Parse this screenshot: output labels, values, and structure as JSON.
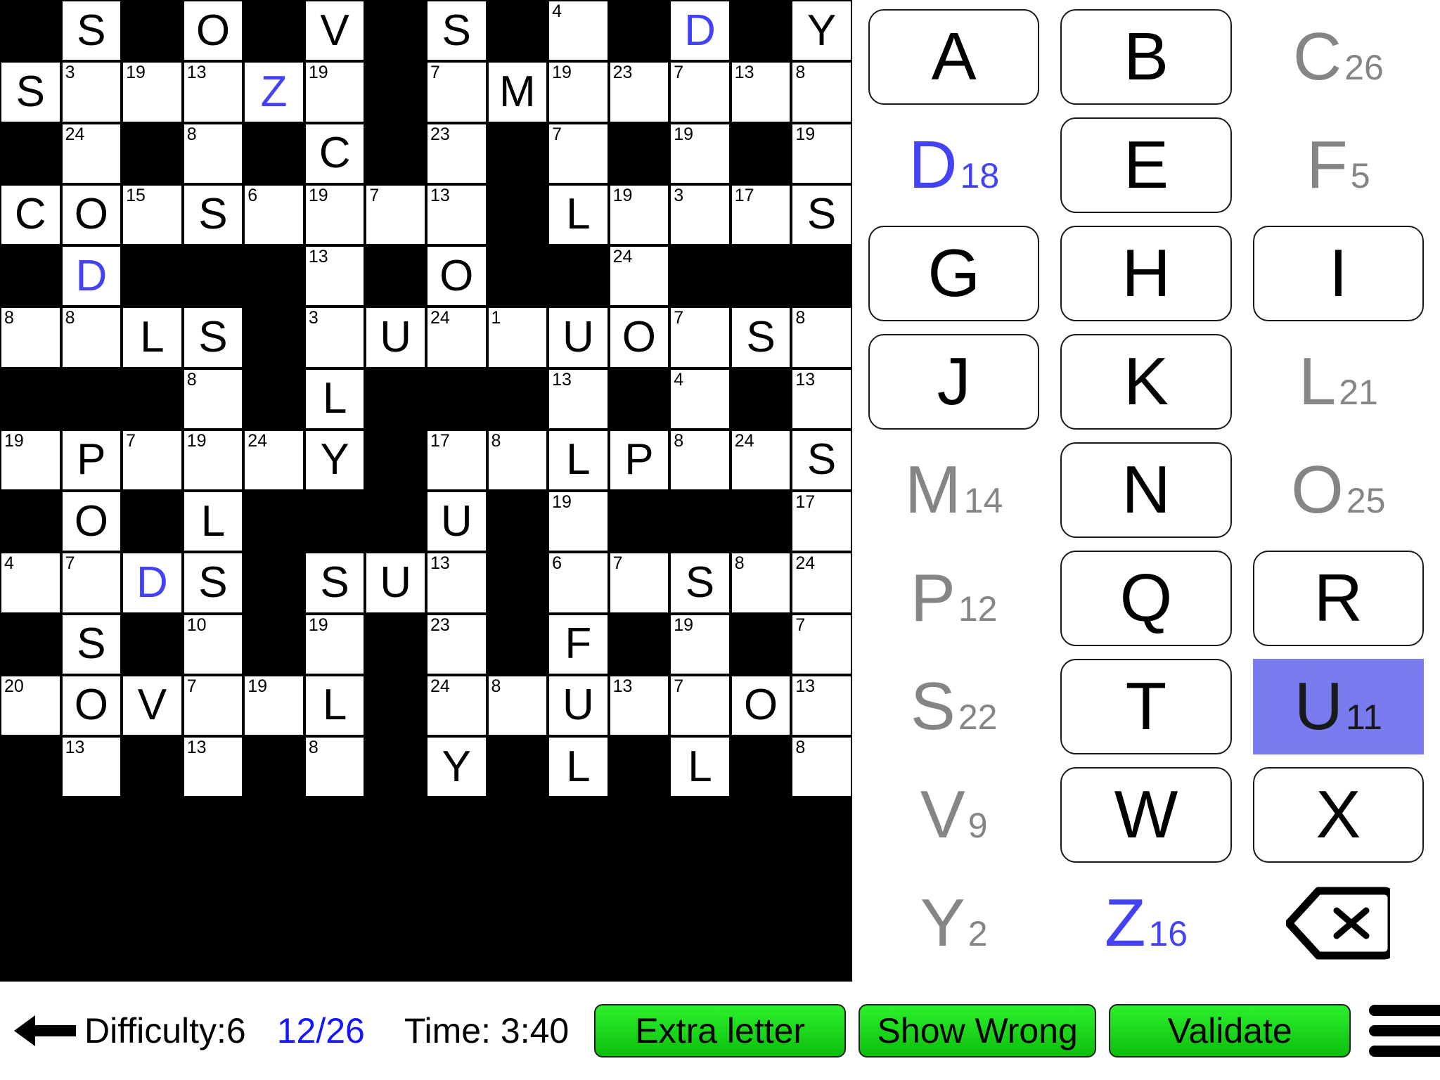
{
  "grid": {
    "rows": 13,
    "cols": 14,
    "cells": [
      [
        {
          "t": "b"
        },
        {
          "t": "o",
          "l": "S"
        },
        {
          "t": "b"
        },
        {
          "t": "o",
          "l": "O"
        },
        {
          "t": "b"
        },
        {
          "t": "o",
          "l": "V"
        },
        {
          "t": "b"
        },
        {
          "t": "o",
          "l": "S"
        },
        {
          "t": "b"
        },
        {
          "t": "o",
          "n": "4"
        },
        {
          "t": "b"
        },
        {
          "t": "o",
          "l": "D",
          "hl": true
        },
        {
          "t": "b"
        },
        {
          "t": "o",
          "l": "Y"
        }
      ],
      [
        {
          "t": "o",
          "l": "S"
        },
        {
          "t": "o",
          "n": "3"
        },
        {
          "t": "o",
          "n": "19"
        },
        {
          "t": "o",
          "n": "13"
        },
        {
          "t": "o",
          "l": "Z",
          "hl": true
        },
        {
          "t": "o",
          "n": "19"
        },
        {
          "t": "b"
        },
        {
          "t": "o",
          "n": "7"
        },
        {
          "t": "o",
          "l": "M"
        },
        {
          "t": "o",
          "n": "19"
        },
        {
          "t": "o",
          "n": "23"
        },
        {
          "t": "o",
          "n": "7"
        },
        {
          "t": "o",
          "n": "13"
        },
        {
          "t": "o",
          "n": "8"
        }
      ],
      [
        {
          "t": "b"
        },
        {
          "t": "o",
          "n": "24"
        },
        {
          "t": "b"
        },
        {
          "t": "o",
          "n": "8"
        },
        {
          "t": "b"
        },
        {
          "t": "o",
          "l": "C"
        },
        {
          "t": "b"
        },
        {
          "t": "o",
          "n": "23"
        },
        {
          "t": "b"
        },
        {
          "t": "o",
          "n": "7"
        },
        {
          "t": "b"
        },
        {
          "t": "o",
          "n": "19"
        },
        {
          "t": "b"
        },
        {
          "t": "o",
          "n": "19"
        }
      ],
      [
        {
          "t": "o",
          "l": "C"
        },
        {
          "t": "o",
          "l": "O"
        },
        {
          "t": "o",
          "n": "15"
        },
        {
          "t": "o",
          "l": "S"
        },
        {
          "t": "o",
          "n": "6"
        },
        {
          "t": "o",
          "n": "19"
        },
        {
          "t": "o",
          "n": "7"
        },
        {
          "t": "o",
          "n": "13"
        },
        {
          "t": "b"
        },
        {
          "t": "o",
          "l": "L"
        },
        {
          "t": "o",
          "n": "19"
        },
        {
          "t": "o",
          "n": "3"
        },
        {
          "t": "o",
          "n": "17"
        },
        {
          "t": "o",
          "l": "S"
        }
      ],
      [
        {
          "t": "b"
        },
        {
          "t": "o",
          "l": "D",
          "hl": true
        },
        {
          "t": "b"
        },
        {
          "t": "b"
        },
        {
          "t": "b"
        },
        {
          "t": "o",
          "n": "13"
        },
        {
          "t": "b"
        },
        {
          "t": "o",
          "l": "O"
        },
        {
          "t": "b"
        },
        {
          "t": "b"
        },
        {
          "t": "o",
          "n": "24"
        },
        {
          "t": "b"
        },
        {
          "t": "b"
        },
        {
          "t": "b"
        }
      ],
      [
        {
          "t": "o",
          "n": "8"
        },
        {
          "t": "o",
          "n": "8"
        },
        {
          "t": "o",
          "l": "L"
        },
        {
          "t": "o",
          "l": "S"
        },
        {
          "t": "b"
        },
        {
          "t": "o",
          "n": "3"
        },
        {
          "t": "o",
          "l": "U"
        },
        {
          "t": "o",
          "n": "24"
        },
        {
          "t": "o",
          "n": "1"
        },
        {
          "t": "o",
          "l": "U"
        },
        {
          "t": "o",
          "l": "O"
        },
        {
          "t": "o",
          "n": "7"
        },
        {
          "t": "o",
          "l": "S"
        },
        {
          "t": "o",
          "n": "8"
        }
      ],
      [
        {
          "t": "b"
        },
        {
          "t": "b"
        },
        {
          "t": "b"
        },
        {
          "t": "o",
          "n": "8"
        },
        {
          "t": "b"
        },
        {
          "t": "o",
          "l": "L"
        },
        {
          "t": "b"
        },
        {
          "t": "b"
        },
        {
          "t": "b"
        },
        {
          "t": "o",
          "n": "13"
        },
        {
          "t": "b"
        },
        {
          "t": "o",
          "n": "4"
        },
        {
          "t": "b"
        },
        {
          "t": "o",
          "n": "13"
        }
      ],
      [
        {
          "t": "o",
          "n": "19"
        },
        {
          "t": "o",
          "l": "P"
        },
        {
          "t": "o",
          "n": "7"
        },
        {
          "t": "o",
          "n": "19"
        },
        {
          "t": "o",
          "n": "24"
        },
        {
          "t": "o",
          "l": "Y"
        },
        {
          "t": "b"
        },
        {
          "t": "o",
          "n": "17"
        },
        {
          "t": "o",
          "n": "8"
        },
        {
          "t": "o",
          "l": "L"
        },
        {
          "t": "o",
          "l": "P"
        },
        {
          "t": "o",
          "n": "8"
        },
        {
          "t": "o",
          "n": "24"
        },
        {
          "t": "o",
          "l": "S"
        }
      ],
      [
        {
          "t": "b"
        },
        {
          "t": "o",
          "l": "O"
        },
        {
          "t": "b"
        },
        {
          "t": "o",
          "l": "L"
        },
        {
          "t": "b"
        },
        {
          "t": "b"
        },
        {
          "t": "b"
        },
        {
          "t": "o",
          "l": "U"
        },
        {
          "t": "b"
        },
        {
          "t": "o",
          "n": "19"
        },
        {
          "t": "b"
        },
        {
          "t": "b"
        },
        {
          "t": "b"
        },
        {
          "t": "o",
          "n": "17"
        }
      ],
      [
        {
          "t": "o",
          "n": "4"
        },
        {
          "t": "o",
          "n": "7"
        },
        {
          "t": "o",
          "l": "D",
          "hl": true
        },
        {
          "t": "o",
          "l": "S"
        },
        {
          "t": "b"
        },
        {
          "t": "o",
          "l": "S"
        },
        {
          "t": "o",
          "l": "U"
        },
        {
          "t": "o",
          "n": "13"
        },
        {
          "t": "b"
        },
        {
          "t": "o",
          "n": "6"
        },
        {
          "t": "o",
          "n": "7"
        },
        {
          "t": "o",
          "l": "S"
        },
        {
          "t": "o",
          "n": "8"
        },
        {
          "t": "o",
          "n": "24"
        }
      ],
      [
        {
          "t": "b"
        },
        {
          "t": "o",
          "l": "S"
        },
        {
          "t": "b"
        },
        {
          "t": "o",
          "n": "10"
        },
        {
          "t": "b"
        },
        {
          "t": "o",
          "n": "19"
        },
        {
          "t": "b"
        },
        {
          "t": "o",
          "n": "23"
        },
        {
          "t": "b"
        },
        {
          "t": "o",
          "l": "F"
        },
        {
          "t": "b"
        },
        {
          "t": "o",
          "n": "19"
        },
        {
          "t": "b"
        },
        {
          "t": "o",
          "n": "7"
        }
      ],
      [
        {
          "t": "o",
          "n": "20"
        },
        {
          "t": "o",
          "l": "O"
        },
        {
          "t": "o",
          "l": "V"
        },
        {
          "t": "o",
          "n": "7"
        },
        {
          "t": "o",
          "n": "19"
        },
        {
          "t": "o",
          "l": "L"
        },
        {
          "t": "b"
        },
        {
          "t": "o",
          "n": "24"
        },
        {
          "t": "o",
          "n": "8"
        },
        {
          "t": "o",
          "l": "U"
        },
        {
          "t": "o",
          "n": "13"
        },
        {
          "t": "o",
          "n": "7"
        },
        {
          "t": "o",
          "l": "O"
        },
        {
          "t": "o",
          "n": "13"
        }
      ],
      [
        {
          "t": "b"
        },
        {
          "t": "o",
          "n": "13"
        },
        {
          "t": "b"
        },
        {
          "t": "o",
          "n": "13"
        },
        {
          "t": "b"
        },
        {
          "t": "o",
          "n": "8"
        },
        {
          "t": "b"
        },
        {
          "t": "o",
          "l": "Y"
        },
        {
          "t": "b"
        },
        {
          "t": "o",
          "l": "L"
        },
        {
          "t": "b"
        },
        {
          "t": "o",
          "l": "L"
        },
        {
          "t": "b"
        },
        {
          "t": "o",
          "n": "8"
        }
      ]
    ]
  },
  "keypad": {
    "keys": [
      {
        "letter": "A",
        "num": "",
        "state": "free"
      },
      {
        "letter": "B",
        "num": "",
        "state": "free"
      },
      {
        "letter": "C",
        "num": "26",
        "state": "used"
      },
      {
        "letter": "D",
        "num": "18",
        "state": "blue"
      },
      {
        "letter": "E",
        "num": "",
        "state": "free"
      },
      {
        "letter": "F",
        "num": "5",
        "state": "used"
      },
      {
        "letter": "G",
        "num": "",
        "state": "free"
      },
      {
        "letter": "H",
        "num": "",
        "state": "free"
      },
      {
        "letter": "I",
        "num": "",
        "state": "free"
      },
      {
        "letter": "J",
        "num": "",
        "state": "free"
      },
      {
        "letter": "K",
        "num": "",
        "state": "free"
      },
      {
        "letter": "L",
        "num": "21",
        "state": "used"
      },
      {
        "letter": "M",
        "num": "14",
        "state": "used"
      },
      {
        "letter": "N",
        "num": "",
        "state": "free"
      },
      {
        "letter": "O",
        "num": "25",
        "state": "used"
      },
      {
        "letter": "P",
        "num": "12",
        "state": "used"
      },
      {
        "letter": "Q",
        "num": "",
        "state": "free"
      },
      {
        "letter": "R",
        "num": "",
        "state": "free"
      },
      {
        "letter": "S",
        "num": "22",
        "state": "used"
      },
      {
        "letter": "T",
        "num": "",
        "state": "free"
      },
      {
        "letter": "U",
        "num": "11",
        "state": "selected"
      },
      {
        "letter": "V",
        "num": "9",
        "state": "used"
      },
      {
        "letter": "W",
        "num": "",
        "state": "free"
      },
      {
        "letter": "X",
        "num": "",
        "state": "free"
      },
      {
        "letter": "Y",
        "num": "2",
        "state": "used"
      },
      {
        "letter": "Z",
        "num": "16",
        "state": "blue"
      }
    ],
    "backspace_icon": "backspace-icon",
    "selected_color": "#7b7bf0",
    "used_color": "#858585",
    "blue_color": "#4343f5"
  },
  "bottombar": {
    "back_icon": "back-arrow-icon",
    "difficulty": "Difficulty:6",
    "progress": "12/26",
    "time": "Time: 3:40",
    "extra_letter": "Extra letter",
    "show_wrong": "Show Wrong",
    "validate": "Validate",
    "menu_icon": "hamburger-menu-icon",
    "button_color": "#1fd11f",
    "progress_color": "#1414ff"
  }
}
